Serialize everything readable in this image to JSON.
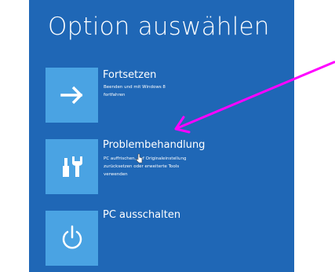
{
  "screen": {
    "title": "Option auswählen",
    "background_color": "#1f67b6",
    "tile_color": "#4aa3e3"
  },
  "options": [
    {
      "title": "Fortsetzen",
      "description_lines": [
        "Beenden und mit Windows 8",
        "fortfahren"
      ],
      "icon": "arrow-right-icon"
    },
    {
      "title": "Problembehandlung",
      "description_lines": [
        "PC auffrischen, auf Originaleinstellung",
        "zurücksetzen oder erweiterte Tools",
        "verwenden"
      ],
      "icon": "tools-icon"
    },
    {
      "title": "PC ausschalten",
      "description_lines": [],
      "icon": "power-icon"
    }
  ],
  "annotation": {
    "arrow_color": "#ff00ff"
  }
}
